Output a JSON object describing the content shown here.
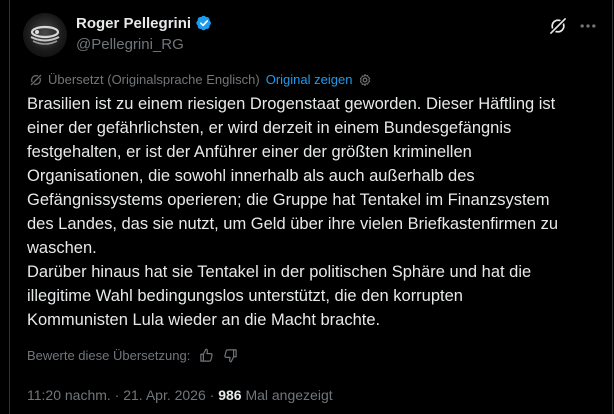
{
  "author": {
    "display_name": "Roger Pellegrini",
    "handle": "@Pellegrini_RG",
    "verified": true
  },
  "translation": {
    "notice": "Übersetzt (Originalsprache Englisch)",
    "show_original": "Original zeigen"
  },
  "tweet": {
    "text": "Brasilien ist zu einem riesigen Drogenstaat geworden. Dieser Häftling ist\neiner der gefährlichsten, er wird derzeit in einem Bundesgefängnis\nfestgehalten, er ist der Anführer einer der größten kriminellen\nOrganisationen, die sowohl innerhalb als auch außerhalb des\nGefängnissystems operieren; die Gruppe hat Tentakel im Finanzsystem\ndes Landes, das sie nutzt, um Geld über ihre vielen Briefkastenfirmen zu\nwaschen.\nDarüber hinaus hat sie Tentakel in der politischen Sphäre und hat die\nillegitime Wahl bedingungslos unterstützt, die den korrupten\nKommunisten Lula wieder an die Macht brachte."
  },
  "rate_translation": {
    "label": "Bewerte diese Übersetzung:"
  },
  "meta": {
    "timestamp": "11:20 nachm. · 21. Apr. 2026 · ",
    "views_count": "986",
    "views_label": " Mal angezeigt"
  },
  "colors": {
    "background": "#000000",
    "text": "#e7e9ea",
    "secondary": "#71767b",
    "accent": "#1d9bf0"
  },
  "icons": {
    "verified": "verified-badge-icon",
    "grok": "grok-icon",
    "more": "more-icon",
    "translate": "translate-icon",
    "settings": "gear-icon",
    "thumbs_up": "thumbs-up-icon",
    "thumbs_down": "thumbs-down-icon"
  }
}
